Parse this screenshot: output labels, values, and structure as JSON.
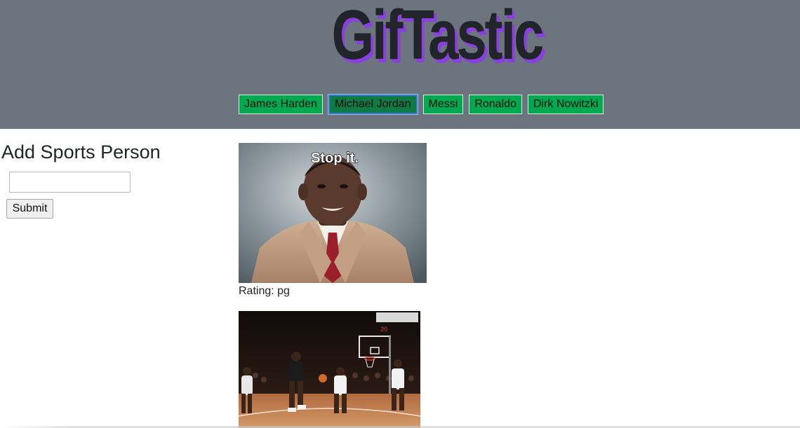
{
  "header": {
    "title": "GifTastic",
    "colors": {
      "background": "#6c757d",
      "title": "#212529",
      "title_shadow": "#8a3fe0",
      "button": "#00a84f"
    }
  },
  "topics": [
    {
      "label": "James Harden",
      "active": false
    },
    {
      "label": "Michael Jordan",
      "active": true
    },
    {
      "label": "Messi",
      "active": false
    },
    {
      "label": "Ronaldo",
      "active": false
    },
    {
      "label": "Dirk Nowitzki",
      "active": false
    }
  ],
  "sidebar": {
    "heading": "Add Sports Person",
    "input_value": "",
    "submit_label": "Submit"
  },
  "gifs": [
    {
      "caption_overlay": "Stop it.",
      "rating_text": "Rating: pg",
      "subject": "man in tan suit speaking"
    },
    {
      "scoreboard_text": "20",
      "subject": "basketball player dribbling on court"
    }
  ]
}
